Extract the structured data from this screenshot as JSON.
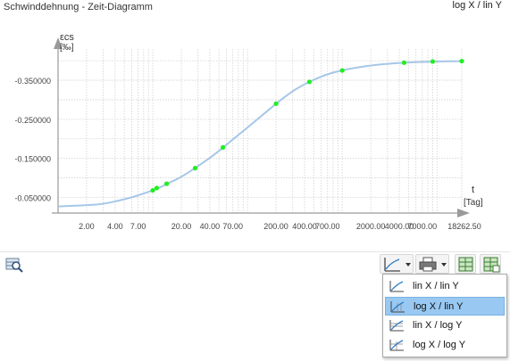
{
  "window": {
    "title": "Schwinddehnung - Zeit-Diagramm",
    "scale_mode": "log X / lin Y"
  },
  "chart_data": {
    "type": "line",
    "x_scale": "log",
    "y_scale": "linear",
    "y_direction": "descending-upward",
    "ylabel_symbol": "εcs",
    "ylabel_unit": "[‰]",
    "xlabel_symbol": "t",
    "xlabel_unit": "[Tag]",
    "xlim": [
      1,
      18262.5
    ],
    "ylim": [
      -0.01,
      -0.43
    ],
    "x_ticks": [
      2,
      4,
      7,
      20,
      40,
      70,
      200,
      400,
      700,
      2000,
      4000,
      7000,
      18262.5
    ],
    "x_tick_labels": [
      "2.00",
      "4.00",
      "7.00",
      "20.00",
      "40.00",
      "70.00",
      "200.00",
      "400.00",
      "700.00",
      "2000.00",
      "4000.00",
      "7000.00",
      "18262.50"
    ],
    "y_ticks": [
      -0.05,
      -0.15,
      -0.25,
      -0.35
    ],
    "y_tick_labels": [
      "-0.050000",
      "-0.150000",
      "-0.250000",
      "-0.350000"
    ],
    "grid": true,
    "series": [
      {
        "color": "#a7c7e8",
        "points": [
          [
            1,
            -0.027
          ],
          [
            2,
            -0.03
          ],
          [
            3,
            -0.033
          ],
          [
            5,
            -0.045
          ],
          [
            7,
            -0.055
          ],
          [
            10,
            -0.068
          ],
          [
            12,
            -0.076
          ],
          [
            15,
            -0.088
          ],
          [
            20,
            -0.102
          ],
          [
            30,
            -0.13
          ],
          [
            45,
            -0.16
          ],
          [
            60,
            -0.185
          ],
          [
            90,
            -0.22
          ],
          [
            130,
            -0.252
          ],
          [
            200,
            -0.29
          ],
          [
            300,
            -0.323
          ],
          [
            400,
            -0.34
          ],
          [
            600,
            -0.36
          ],
          [
            800,
            -0.37
          ],
          [
            1200,
            -0.38
          ],
          [
            2000,
            -0.388
          ],
          [
            3000,
            -0.392
          ],
          [
            5000,
            -0.396
          ],
          [
            7000,
            -0.397
          ],
          [
            10000,
            -0.398
          ],
          [
            18262.5,
            -0.399
          ]
        ]
      }
    ],
    "markers": {
      "color": "#22ee22",
      "points": [
        [
          10,
          -0.068
        ],
        [
          11,
          -0.074
        ],
        [
          14,
          -0.085
        ],
        [
          28,
          -0.125
        ],
        [
          55,
          -0.178
        ],
        [
          200,
          -0.29
        ],
        [
          450,
          -0.346
        ],
        [
          1000,
          -0.375
        ],
        [
          4500,
          -0.395
        ],
        [
          9000,
          -0.398
        ],
        [
          18262.5,
          -0.399
        ]
      ]
    }
  },
  "toolbar": {
    "icons": [
      "zoom-table-icon",
      "chart-axis-scale-icon",
      "print-icon",
      "export-table-icon",
      "export-table-all-icon"
    ]
  },
  "scale_menu": {
    "selected_index": 1,
    "items": [
      {
        "label": "lin X / lin Y"
      },
      {
        "label": "log X / lin Y"
      },
      {
        "label": "lin X / log Y"
      },
      {
        "label": "log X / log Y"
      }
    ]
  }
}
